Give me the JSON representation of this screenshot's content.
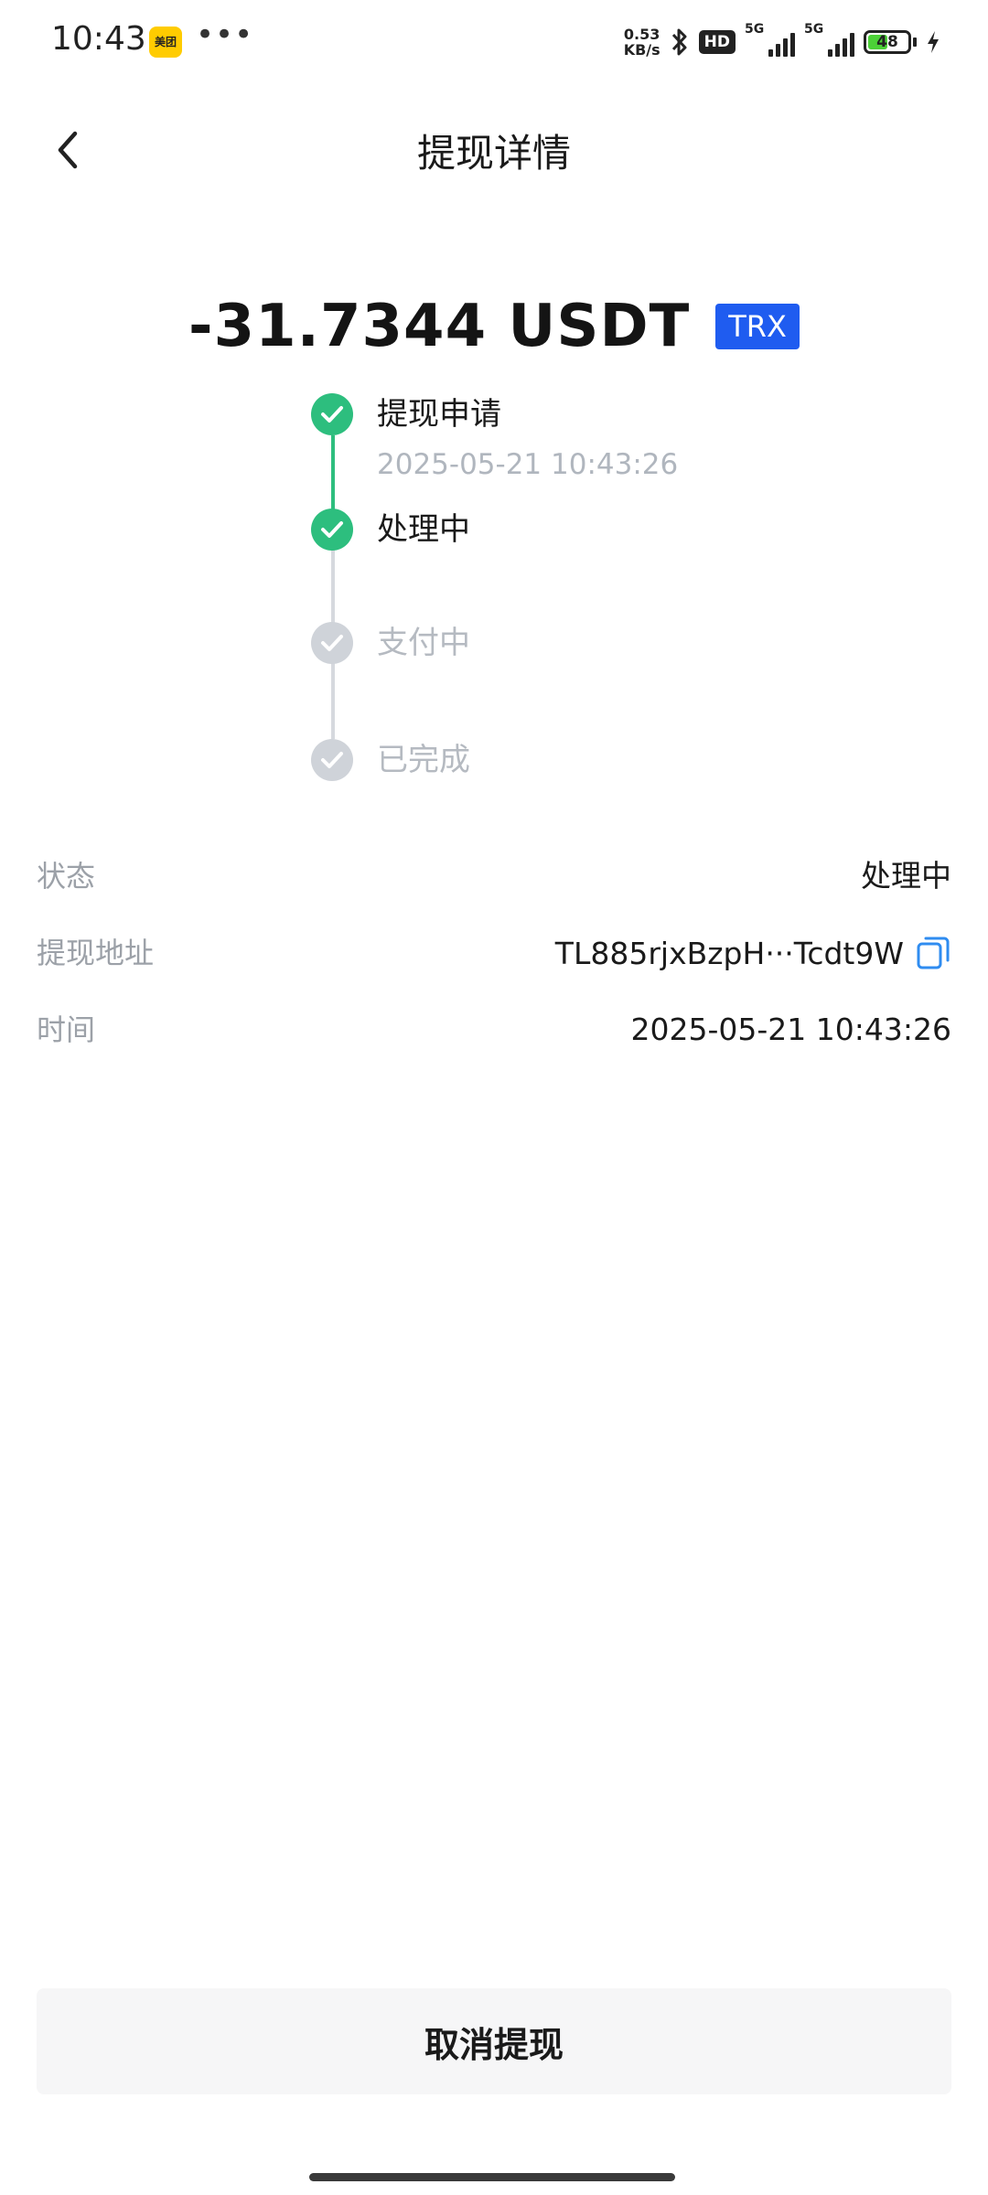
{
  "statusbar": {
    "time": "10:43",
    "app_badge": "美团",
    "dots": "•••",
    "speed_value": "0.53",
    "speed_unit": "KB/s",
    "hd_label": "HD",
    "network1": "5G",
    "network2": "5G",
    "battery": "48"
  },
  "header": {
    "title": "提现详情"
  },
  "amount": {
    "value": "-31.7344 USDT",
    "chain": "TRX"
  },
  "timeline": {
    "steps": [
      {
        "label": "提现申请",
        "time": "2025-05-21 10:43:26",
        "status": "done"
      },
      {
        "label": "处理中",
        "status": "done"
      },
      {
        "label": "支付中",
        "status": "pending"
      },
      {
        "label": "已完成",
        "status": "pending"
      }
    ]
  },
  "details": {
    "status_label": "状态",
    "status_value": "处理中",
    "address_label": "提现地址",
    "address_value": "TL885rjxBzpH···Tcdt9W",
    "time_label": "时间",
    "time_value": "2025-05-21 10:43:26"
  },
  "actions": {
    "cancel_label": "取消提现"
  },
  "colors": {
    "done": "#2DBE7E",
    "pending": "#CFD3D9",
    "chain_badge": "#1F5CF0",
    "copy_icon": "#2F8CF0"
  }
}
